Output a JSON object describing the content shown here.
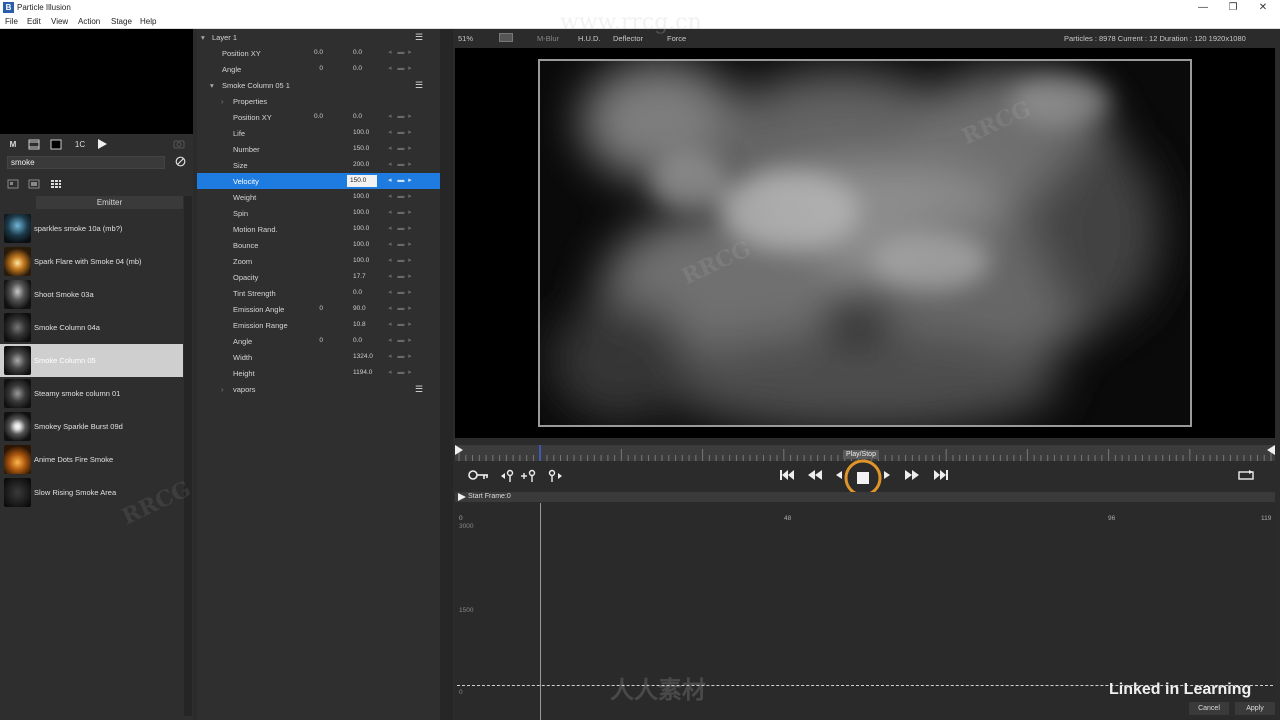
{
  "window": {
    "title": "Particle Illusion",
    "logo_letter": "B",
    "controls": {
      "minimize": "—",
      "maximize": "❐",
      "close": "✕"
    }
  },
  "menu": [
    "File",
    "Edit",
    "View",
    "Action",
    "Stage",
    "Help"
  ],
  "left_panel": {
    "tool_label": "M",
    "tool_number": "1C",
    "search_value": "smoke",
    "emitter_header": "Emitter",
    "emitters": [
      {
        "name": "sparkles smoke 10a (mb?)",
        "selected": false
      },
      {
        "name": "Spark Flare with Smoke 04 (mb)",
        "selected": false
      },
      {
        "name": "Shoot Smoke 03a",
        "selected": false
      },
      {
        "name": "Smoke Column 04a",
        "selected": false
      },
      {
        "name": "Smoke Column 05",
        "selected": true
      },
      {
        "name": "Steamy smoke column 01",
        "selected": false
      },
      {
        "name": "Smokey Sparkle Burst 09d",
        "selected": false
      },
      {
        "name": "Anime Dots Fire Smoke",
        "selected": false
      },
      {
        "name": "Slow Rising Smoke Area",
        "selected": false
      }
    ]
  },
  "properties": {
    "layer": {
      "label": "Layer 1"
    },
    "layer_props": [
      {
        "label": "Position XY",
        "v1": "0.0",
        "v2": "0.0"
      },
      {
        "label": "Angle",
        "v1": "0",
        "v2": "0.0"
      }
    ],
    "emitter": {
      "label": "Smoke Column 05 1"
    },
    "group_properties": "Properties",
    "emitter_props": [
      {
        "label": "Position XY",
        "v1": "0.0",
        "v2": "0.0",
        "selected": false
      },
      {
        "label": "Life",
        "v1": "",
        "v2": "100.0",
        "selected": false
      },
      {
        "label": "Number",
        "v1": "",
        "v2": "150.0",
        "selected": false
      },
      {
        "label": "Size",
        "v1": "",
        "v2": "200.0",
        "selected": false
      },
      {
        "label": "Velocity",
        "v1": "",
        "v2": "150.0",
        "selected": true
      },
      {
        "label": "Weight",
        "v1": "",
        "v2": "100.0",
        "selected": false
      },
      {
        "label": "Spin",
        "v1": "",
        "v2": "100.0",
        "selected": false
      },
      {
        "label": "Motion Rand.",
        "v1": "",
        "v2": "100.0",
        "selected": false
      },
      {
        "label": "Bounce",
        "v1": "",
        "v2": "100.0",
        "selected": false
      },
      {
        "label": "Zoom",
        "v1": "",
        "v2": "100.0",
        "selected": false
      },
      {
        "label": "Opacity",
        "v1": "",
        "v2": "17.7",
        "selected": false
      },
      {
        "label": "Tint Strength",
        "v1": "",
        "v2": "0.0",
        "selected": false
      },
      {
        "label": "Emission Angle",
        "v1": "0",
        "v2": "90.0",
        "selected": false
      },
      {
        "label": "Emission Range",
        "v1": "",
        "v2": "10.8",
        "selected": false
      },
      {
        "label": "Angle",
        "v1": "0",
        "v2": "0.0",
        "selected": false
      },
      {
        "label": "Width",
        "v1": "",
        "v2": "1324.0",
        "selected": false
      },
      {
        "label": "Height",
        "v1": "",
        "v2": "1194.0",
        "selected": false
      }
    ],
    "sub_group": "vapors"
  },
  "viewer": {
    "zoom": "51%",
    "toggles": [
      "M-Blur",
      "H.U.D.",
      "Deflector",
      "Force"
    ],
    "stats": "Particles : 8978    Current : 12    Duration : 120    1920x1080"
  },
  "transport": {
    "tooltip": "Play/Stop",
    "start_frame": "Start Frame:0"
  },
  "graph": {
    "x_ticks": [
      "0",
      "48",
      "96",
      "119"
    ],
    "y_ticks": [
      "3000",
      "1500",
      "0"
    ]
  },
  "footer": {
    "cancel_label": "Cancel",
    "apply_label": "Apply",
    "brand": "Linked in Learning"
  },
  "watermark": {
    "site": "www.rrcg.cn",
    "text": "RRCG",
    "cn": "人人素材"
  }
}
